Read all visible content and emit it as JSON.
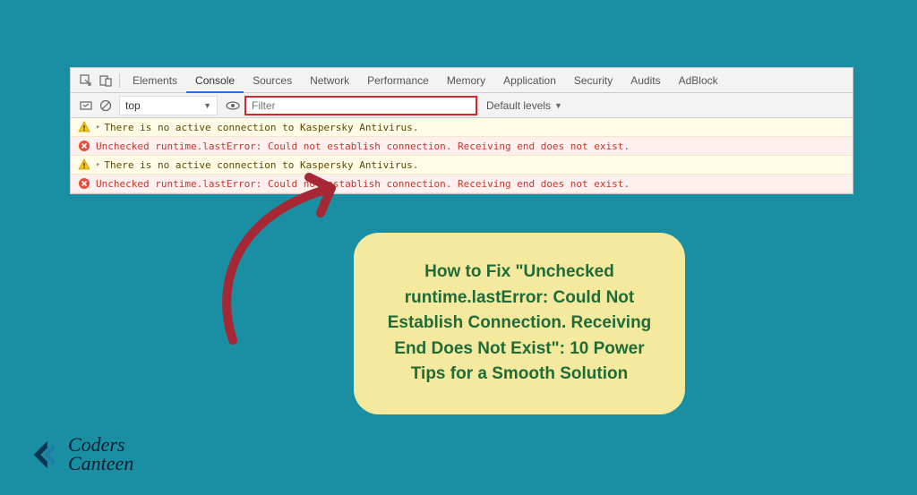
{
  "devtools": {
    "tabs": {
      "elements": "Elements",
      "console": "Console",
      "sources": "Sources",
      "network": "Network",
      "performance": "Performance",
      "memory": "Memory",
      "application": "Application",
      "security": "Security",
      "audits": "Audits",
      "adblock": "AdBlock"
    },
    "filter_bar": {
      "context": "top",
      "filter_placeholder": "Filter",
      "levels_label": "Default levels"
    },
    "logs": [
      {
        "type": "warn",
        "text": "There is no active connection to Kaspersky Antivirus."
      },
      {
        "type": "error",
        "text": "Unchecked runtime.lastError: Could not establish connection. Receiving end does not exist."
      },
      {
        "type": "warn",
        "text": "There is no active connection to Kaspersky Antivirus."
      },
      {
        "type": "error",
        "text": "Unchecked runtime.lastError: Could not establish connection. Receiving end does not exist."
      }
    ]
  },
  "callout": {
    "title": "How to Fix \"Unchecked runtime.lastError: Could Not Establish Connection. Receiving End Does Not Exist\": 10 Power Tips for a Smooth Solution"
  },
  "brand": {
    "line1": "Coders",
    "line2": "Canteen"
  },
  "colors": {
    "page_bg": "#1a8fa3",
    "callout_bg": "#f5e99e",
    "callout_text": "#1f6b3a",
    "arrow": "#a52834",
    "filter_highlight": "#d62828"
  }
}
